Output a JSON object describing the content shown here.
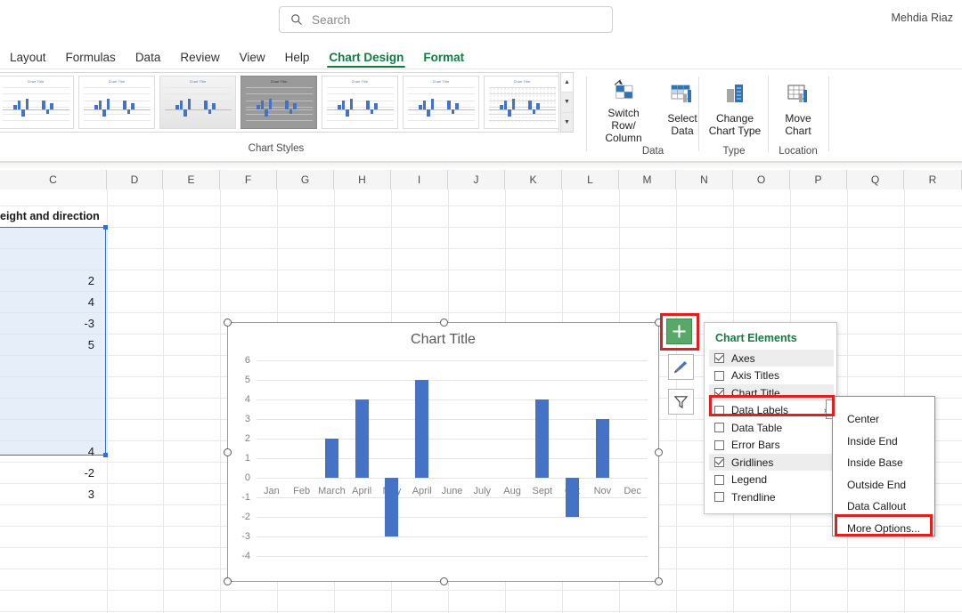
{
  "app": {
    "user_name": "Mehdia Riaz"
  },
  "search": {
    "placeholder": "Search",
    "icon": "search-icon"
  },
  "ribbon": {
    "tabs": [
      {
        "label": "Layout",
        "state": "partial"
      },
      {
        "label": "Formulas",
        "state": "normal"
      },
      {
        "label": "Data",
        "state": "normal"
      },
      {
        "label": "Review",
        "state": "normal"
      },
      {
        "label": "View",
        "state": "normal"
      },
      {
        "label": "Help",
        "state": "normal"
      },
      {
        "label": "Chart Design",
        "state": "active-contextual"
      },
      {
        "label": "Format",
        "state": "contextual"
      }
    ],
    "groups": [
      {
        "label": "Chart Styles"
      },
      {
        "label": "Data"
      },
      {
        "label": "Type"
      },
      {
        "label": "Location"
      }
    ],
    "buttons": [
      {
        "label": "Switch Row/\nColumn",
        "line1": "Switch Row/",
        "line2": "Column",
        "icon": "switch-row-column-icon"
      },
      {
        "label": "Select Data",
        "line1": "Select",
        "line2": "Data",
        "icon": "select-data-icon"
      },
      {
        "label": "Change Chart Type",
        "line1": "Change",
        "line2": "Chart Type",
        "icon": "change-chart-type-icon"
      },
      {
        "label": "Move Chart",
        "line1": "Move",
        "line2": "Chart",
        "icon": "move-chart-icon"
      }
    ],
    "gallery": {
      "thumb_title": "Chart Title",
      "selected_index": 3,
      "count": 7,
      "scroll_up": "▲",
      "scroll_down": "▼",
      "scroll_more": "▼"
    }
  },
  "sheet": {
    "column_headers": [
      "C",
      "D",
      "E",
      "F",
      "G",
      "H",
      "I",
      "J",
      "K",
      "L",
      "M",
      "N",
      "O",
      "P",
      "Q",
      "R"
    ],
    "c_header_text": "eight and direction",
    "selected_values": [
      {
        "row": 3,
        "value": "2"
      },
      {
        "row": 4,
        "value": "4"
      },
      {
        "row": 5,
        "value": "-3"
      },
      {
        "row": 6,
        "value": "5"
      },
      {
        "row": 11,
        "value": "4"
      },
      {
        "row": 12,
        "value": "-2"
      },
      {
        "row": 13,
        "value": "3"
      }
    ]
  },
  "chart": {
    "title": "Chart Title",
    "bar_color": "#4472C4",
    "side_buttons": [
      {
        "name": "chart-elements-button",
        "glyph": "+",
        "active": true
      },
      {
        "name": "chart-styles-button",
        "glyph": "brush",
        "active": false
      },
      {
        "name": "chart-filters-button",
        "glyph": "funnel",
        "active": false
      }
    ]
  },
  "chart_data": {
    "type": "bar",
    "title": "Chart Title",
    "xlabel": "",
    "ylabel": "",
    "categories": [
      "Jan",
      "Feb",
      "March",
      "April",
      "May",
      "April",
      "June",
      "July",
      "Aug",
      "Sept",
      "Oct",
      "Nov",
      "Dec"
    ],
    "values": [
      0,
      0,
      2,
      4,
      -3,
      5,
      0,
      0,
      0,
      4,
      -2,
      3,
      0
    ],
    "ylim": [
      -4,
      6
    ],
    "yticks": [
      6,
      5,
      4,
      3,
      2,
      1,
      0,
      -1,
      -2,
      -3,
      -4
    ],
    "grid": true,
    "legend": false,
    "series": [
      {
        "name": "Height and direction",
        "values": [
          0,
          0,
          2,
          4,
          -3,
          5,
          0,
          0,
          0,
          4,
          -2,
          3,
          0
        ]
      }
    ]
  },
  "chart_elements_panel": {
    "title": "Chart Elements",
    "items": [
      {
        "label": "Axes",
        "checked": true,
        "highlight": true,
        "submenu": false
      },
      {
        "label": "Axis Titles",
        "checked": false,
        "highlight": false,
        "submenu": false
      },
      {
        "label": "Chart Title",
        "checked": true,
        "highlight": true,
        "submenu": false
      },
      {
        "label": "Data Labels",
        "checked": false,
        "highlight": false,
        "submenu": true
      },
      {
        "label": "Data Table",
        "checked": false,
        "highlight": false,
        "submenu": false
      },
      {
        "label": "Error Bars",
        "checked": false,
        "highlight": false,
        "submenu": false
      },
      {
        "label": "Gridlines",
        "checked": true,
        "highlight": true,
        "submenu": false
      },
      {
        "label": "Legend",
        "checked": false,
        "highlight": false,
        "submenu": false
      },
      {
        "label": "Trendline",
        "checked": false,
        "highlight": false,
        "submenu": false
      }
    ],
    "submenu_arrow": "›"
  },
  "data_labels_submenu": {
    "items": [
      {
        "label": "Center",
        "highlighted": false
      },
      {
        "label": "Inside End",
        "highlighted": false
      },
      {
        "label": "Inside Base",
        "highlighted": false
      },
      {
        "label": "Outside End",
        "highlighted": false
      },
      {
        "label": "Data Callout",
        "highlighted": false
      },
      {
        "label": "More Options...",
        "highlighted": true
      }
    ]
  },
  "annotations": {
    "highlight_color": "#E02020",
    "targets": [
      "chart-elements-button",
      "data-labels-item",
      "more-options-item"
    ]
  }
}
